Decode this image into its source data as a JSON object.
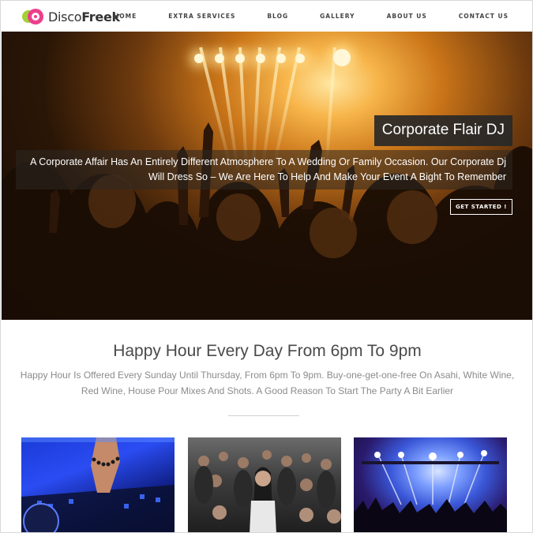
{
  "logo": {
    "part1": "Disco",
    "part2": "Freek"
  },
  "nav": {
    "items": [
      {
        "label": "HOME"
      },
      {
        "label": "EXTRA SERVICES"
      },
      {
        "label": "BLOG"
      },
      {
        "label": "GALLERY"
      },
      {
        "label": "ABOUT US"
      },
      {
        "label": "CONTACT US"
      }
    ]
  },
  "hero": {
    "title": "Corporate Flair DJ",
    "description": "A Corporate Affair Has An Entirely Different Atmosphere To A Wedding Or Family Occasion. Our Corporate Dj Will Dress So – We Are Here To Help And Make Your Event A Bight To Remember",
    "button": "GET STARTED !"
  },
  "intro": {
    "title": "Happy Hour Every Day From 6pm To 9pm",
    "text": "Happy Hour Is Offered Every Sunday Until Thursday, From 6pm To 9pm. Buy-one-get-one-free On Asahi, White Wine, Red Wine, House Pour Mixes And Shots. A Good Reason To Start The Party A Bit Earlier"
  },
  "gallery": {
    "items": [
      {
        "icon": "dj-mixer-photo"
      },
      {
        "icon": "dancing-crowd-photo"
      },
      {
        "icon": "concert-lights-photo"
      }
    ]
  },
  "colors": {
    "logo_green": "#a3d13a",
    "logo_pink": "#ec3f8c",
    "title_box": "#282828",
    "text_gray": "#8b8b8b"
  }
}
